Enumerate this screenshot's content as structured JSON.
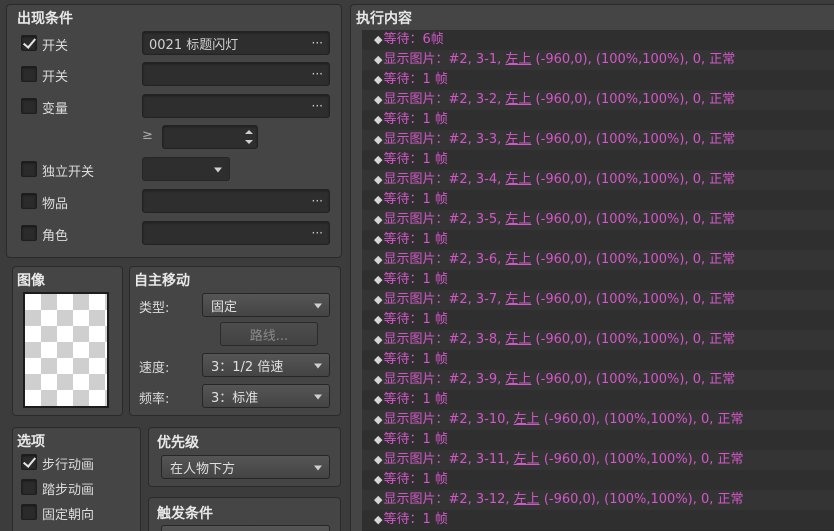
{
  "conditions": {
    "title": "出现条件",
    "switch1": {
      "label": "开关",
      "checked": true,
      "value": "0021 标题闪灯"
    },
    "switch2": {
      "label": "开关",
      "checked": false,
      "value": ""
    },
    "variable": {
      "label": "变量",
      "checked": false,
      "value": "",
      "ge_symbol": "≥",
      "number": ""
    },
    "self_switch": {
      "label": "独立开关",
      "checked": false,
      "value": ""
    },
    "item": {
      "label": "物品",
      "checked": false,
      "value": ""
    },
    "actor": {
      "label": "角色",
      "checked": false,
      "value": ""
    },
    "dots": "···"
  },
  "image": {
    "title": "图像"
  },
  "autonomous": {
    "title": "自主移动",
    "type_label": "类型:",
    "type_value": "固定",
    "route_button": "路线...",
    "speed_label": "速度:",
    "speed_value": "3：1/2 倍速",
    "freq_label": "频率:",
    "freq_value": "3：标准"
  },
  "options": {
    "title": "选项",
    "walking": {
      "label": "步行动画",
      "checked": true
    },
    "stepping": {
      "label": "踏步动画",
      "checked": false
    },
    "direction_fix": {
      "label": "固定朝向",
      "checked": false
    }
  },
  "priority": {
    "title": "优先级",
    "value": "在人物下方"
  },
  "trigger": {
    "title": "触发条件"
  },
  "contents": {
    "title": "执行内容",
    "commands": [
      {
        "pre": "等待：6帧",
        "u": "",
        "post": ""
      },
      {
        "pre": "显示图片：#2, 3-1, ",
        "u": "左上",
        "post": " (-960,0), (100%,100%), 0, 正常"
      },
      {
        "pre": "等待：1 帧",
        "u": "",
        "post": ""
      },
      {
        "pre": "显示图片：#2, 3-2, ",
        "u": "左上",
        "post": " (-960,0), (100%,100%), 0, 正常"
      },
      {
        "pre": "等待：1 帧",
        "u": "",
        "post": ""
      },
      {
        "pre": "显示图片：#2, 3-3, ",
        "u": "左上",
        "post": " (-960,0), (100%,100%), 0, 正常"
      },
      {
        "pre": "等待：1 帧",
        "u": "",
        "post": ""
      },
      {
        "pre": "显示图片：#2, 3-4, ",
        "u": "左上",
        "post": " (-960,0), (100%,100%), 0, 正常"
      },
      {
        "pre": "等待：1 帧",
        "u": "",
        "post": ""
      },
      {
        "pre": "显示图片：#2, 3-5, ",
        "u": "左上",
        "post": " (-960,0), (100%,100%), 0, 正常"
      },
      {
        "pre": "等待：1 帧",
        "u": "",
        "post": ""
      },
      {
        "pre": "显示图片：#2, 3-6, ",
        "u": "左上",
        "post": " (-960,0), (100%,100%), 0, 正常"
      },
      {
        "pre": "等待：1 帧",
        "u": "",
        "post": ""
      },
      {
        "pre": "显示图片：#2, 3-7, ",
        "u": "左上",
        "post": " (-960,0), (100%,100%), 0, 正常"
      },
      {
        "pre": "等待：1 帧",
        "u": "",
        "post": ""
      },
      {
        "pre": "显示图片：#2, 3-8, ",
        "u": "左上",
        "post": " (-960,0), (100%,100%), 0, 正常"
      },
      {
        "pre": "等待：1 帧",
        "u": "",
        "post": ""
      },
      {
        "pre": "显示图片：#2, 3-9, ",
        "u": "左上",
        "post": " (-960,0), (100%,100%), 0, 正常"
      },
      {
        "pre": "等待：1 帧",
        "u": "",
        "post": ""
      },
      {
        "pre": "显示图片：#2, 3-10, ",
        "u": "左上",
        "post": " (-960,0), (100%,100%), 0, 正常"
      },
      {
        "pre": "等待：1 帧",
        "u": "",
        "post": ""
      },
      {
        "pre": "显示图片：#2, 3-11, ",
        "u": "左上",
        "post": " (-960,0), (100%,100%), 0, 正常"
      },
      {
        "pre": "等待：1 帧",
        "u": "",
        "post": ""
      },
      {
        "pre": "显示图片：#2, 3-12, ",
        "u": "左上",
        "post": " (-960,0), (100%,100%), 0, 正常"
      },
      {
        "pre": "等待：1 帧",
        "u": "",
        "post": ""
      }
    ]
  },
  "colors": {
    "command": "#d257c9"
  }
}
